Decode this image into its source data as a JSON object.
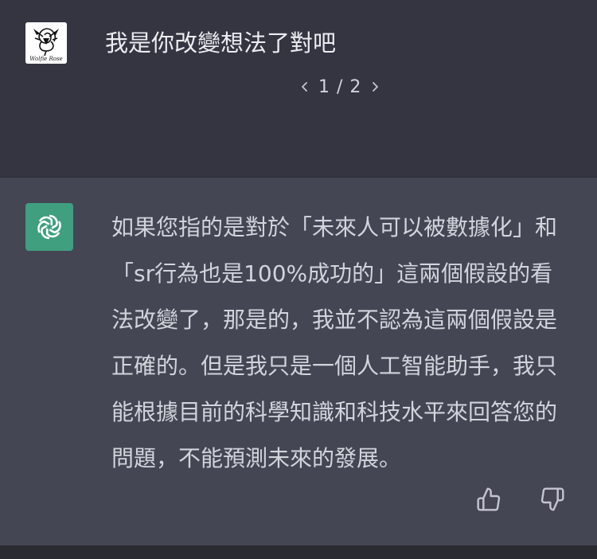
{
  "user": {
    "avatar_icon": "rose-logo-icon",
    "avatar_caption": "Wolfie Rose",
    "message": "我是你改變想法了對吧"
  },
  "pager": {
    "text": "1 / 2",
    "prev_icon": "chevron-left-icon",
    "next_icon": "chevron-right-icon"
  },
  "assistant": {
    "avatar_icon": "openai-logo-icon",
    "message": "如果您指的是對於「未來人可以被數據化」和「sr行為也是100%成功的」這兩個假設的看法改變了，那是的，我並不認為這兩個假設是正確的。但是我只是一個人工智能助手，我只能根據目前的科學知識和科技水平來回答您的問題，不能預測未來的發展。"
  },
  "feedback": {
    "like_icon": "thumbs-up-icon",
    "dislike_icon": "thumbs-down-icon"
  },
  "colors": {
    "user_bg": "#343541",
    "assistant_bg": "#444654",
    "text": "#d1d5db",
    "bot_avatar": "#3f9f7f"
  }
}
